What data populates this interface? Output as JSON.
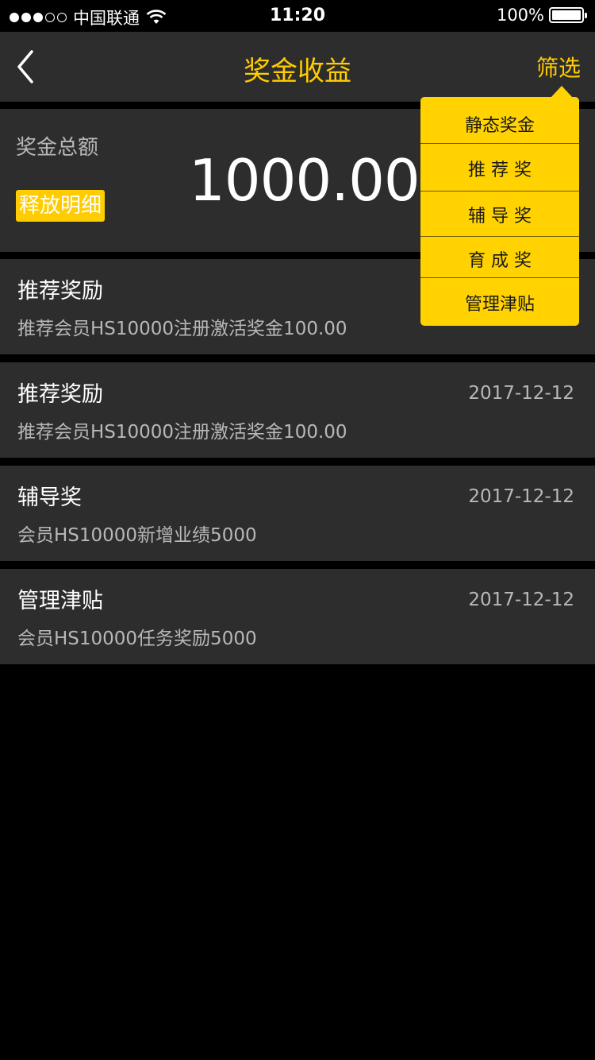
{
  "status_bar": {
    "carrier": "中国联通",
    "time": "11:20",
    "battery": "100%"
  },
  "nav": {
    "title": "奖金收益",
    "filter_label": "筛选",
    "accent_color": "#ffcc00"
  },
  "summary": {
    "total_label": "奖金总额",
    "total_amount": "1000.00",
    "release_detail_label": "释放明细"
  },
  "filter_menu": {
    "items": [
      {
        "label": "静态奖金"
      },
      {
        "label": "推 荐 奖"
      },
      {
        "label": "辅 导 奖"
      },
      {
        "label": "育 成 奖"
      },
      {
        "label": "管理津贴"
      }
    ]
  },
  "records": [
    {
      "title": "推荐奖励",
      "date": "",
      "desc": "推荐会员HS10000注册激活奖金100.00"
    },
    {
      "title": "推荐奖励",
      "date": "2017-12-12",
      "desc": "推荐会员HS10000注册激活奖金100.00"
    },
    {
      "title": "辅导奖",
      "date": "2017-12-12",
      "desc": "会员HS10000新增业绩5000"
    },
    {
      "title": "管理津贴",
      "date": "2017-12-12",
      "desc": "会员HS10000任务奖励5000"
    }
  ]
}
